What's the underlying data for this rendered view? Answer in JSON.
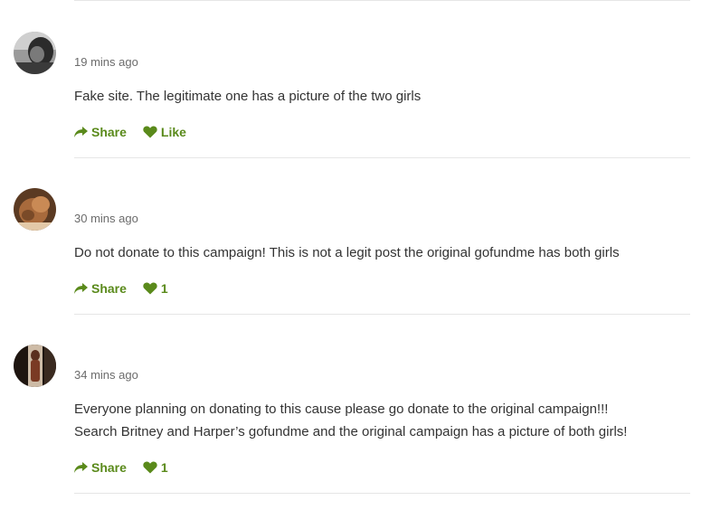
{
  "colors": {
    "accent": "#5a8a1b",
    "text": "#333333",
    "muted": "#6b6b6b",
    "divider": "#e6e6e6"
  },
  "comments": [
    {
      "avatar_icon": "user-avatar-photo",
      "timestamp": "19 mins ago",
      "text_lines": [
        "Fake site. The legitimate one has a picture of the two girls"
      ],
      "share_label": "Share",
      "share_icon": "share-arrow-icon",
      "like_icon": "heart-icon",
      "like_label": "Like"
    },
    {
      "avatar_icon": "user-avatar-photo",
      "timestamp": "30 mins ago",
      "text_lines": [
        "Do not donate to this campaign! This is not a legit post the original gofundme has both girls"
      ],
      "share_label": "Share",
      "share_icon": "share-arrow-icon",
      "like_icon": "heart-icon",
      "like_label": "1"
    },
    {
      "avatar_icon": "user-avatar-photo",
      "timestamp": "34 mins ago",
      "text_lines": [
        "Everyone planning on donating to this cause please go donate to the original campaign!!!",
        "Search Britney and Harper’s gofundme and the original campaign has a picture of both girls!"
      ],
      "share_label": "Share",
      "share_icon": "share-arrow-icon",
      "like_icon": "heart-icon",
      "like_label": "1"
    }
  ]
}
